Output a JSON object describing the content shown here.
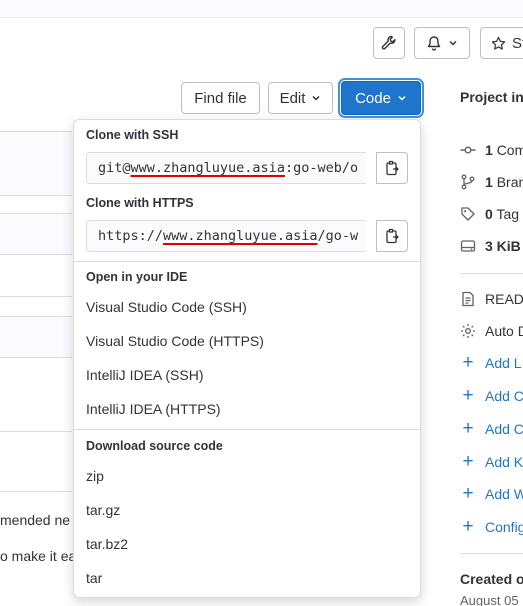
{
  "toolbar": {
    "bell_chevron": "⌄",
    "star_label": "St"
  },
  "repo_actions": {
    "find_file": "Find file",
    "edit": "Edit",
    "code": "Code"
  },
  "left_fragments": {
    "line1": "mended ne",
    "line2": "o make it ea"
  },
  "code_dropdown": {
    "ssh": {
      "heading": "Clone with SSH",
      "prefix": "git@",
      "host": "www.zhangluyue.asia",
      "suffix": ":go-web/o"
    },
    "https": {
      "heading": "Clone with HTTPS",
      "prefix": "https://",
      "host": "www.zhangluyue.asia",
      "suffix": "/go-w"
    },
    "ide": {
      "heading": "Open in your IDE",
      "items": [
        "Visual Studio Code (SSH)",
        "Visual Studio Code (HTTPS)",
        "IntelliJ IDEA (SSH)",
        "IntelliJ IDEA (HTTPS)"
      ]
    },
    "download": {
      "heading": "Download source code",
      "items": [
        "zip",
        "tar.gz",
        "tar.bz2",
        "tar"
      ]
    }
  },
  "sidebar": {
    "title": "Project in",
    "stats": [
      {
        "count": "1",
        "label": "Com",
        "icon": "commit-icon"
      },
      {
        "count": "1",
        "label": "Bran",
        "icon": "branch-icon"
      },
      {
        "count": "0",
        "label": "Tag",
        "icon": "tag-icon"
      },
      {
        "count": "3 KiB",
        "label": "",
        "icon": "storage-icon"
      }
    ],
    "files": [
      {
        "label": "READ",
        "icon": "document-icon"
      },
      {
        "label": "Auto D",
        "icon": "settings-icon"
      }
    ],
    "add_links": [
      "Add L",
      "Add C",
      "Add C",
      "Add K",
      "Add W",
      "Config"
    ],
    "created_title": "Created o",
    "created_date": "August 05"
  },
  "colors": {
    "accent": "#1f75cb",
    "underline": "#e00000",
    "border": "#dcdcde"
  }
}
